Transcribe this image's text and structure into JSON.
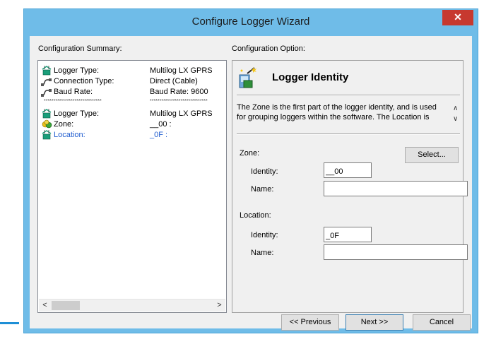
{
  "window": {
    "title": "Configure Logger Wizard",
    "close_glyph": "✕"
  },
  "summary": {
    "heading": "Configuration Summary:",
    "rows": [
      {
        "icon": "logger-icon",
        "label": "Logger Type:",
        "value": "Multilog LX GPRS"
      },
      {
        "icon": "cable-icon",
        "label": "Connection Type:",
        "value": "Direct (Cable)"
      },
      {
        "icon": "cable-icon",
        "label": "Baud Rate:",
        "value": "Baud Rate: 9600"
      },
      {
        "icon": "",
        "label": "******************************",
        "value": "******************************"
      },
      {
        "icon": "logger-icon",
        "label": "Logger Type:",
        "value": "Multilog LX GPRS"
      },
      {
        "icon": "zone-icon",
        "label": "Zone:",
        "value": "__00 :"
      },
      {
        "icon": "logger-icon",
        "label": "Location:",
        "value": "_0F :"
      }
    ],
    "scroll_left": "<",
    "scroll_right": ">"
  },
  "option": {
    "heading": "Configuration Option:",
    "title": "Logger Identity",
    "description": "The Zone is the first part of the logger identity, and is used for grouping loggers within the software. The Location is",
    "desc_up": "∧",
    "desc_down": "∨",
    "zone_label": "Zone:",
    "select_label": "Select...",
    "zone_identity_label": "Identity:",
    "zone_identity_value": "__00",
    "zone_name_label": "Name:",
    "zone_name_value": "",
    "location_label": "Location:",
    "location_identity_label": "Identity:",
    "location_identity_value": "_0F",
    "location_name_label": "Name:",
    "location_name_value": ""
  },
  "buttons": {
    "previous": "<< Previous",
    "next": "Next >>",
    "cancel": "Cancel"
  },
  "colors": {
    "titlebar": "#6fbce8",
    "close": "#c7392f",
    "link": "#1f5ccf",
    "accent": "#1e8fd6"
  }
}
